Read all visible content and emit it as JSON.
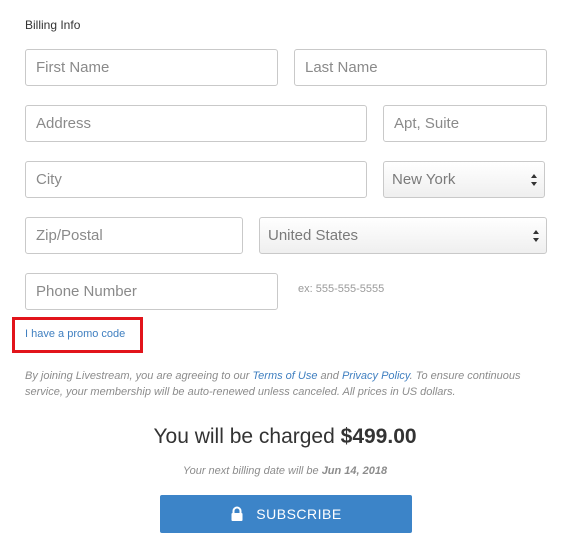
{
  "form": {
    "section_title": "Billing Info",
    "first_name": {
      "placeholder": "First Name",
      "value": ""
    },
    "last_name": {
      "placeholder": "Last Name",
      "value": ""
    },
    "address": {
      "placeholder": "Address",
      "value": ""
    },
    "apt_suite": {
      "placeholder": "Apt, Suite",
      "value": ""
    },
    "city": {
      "placeholder": "City",
      "value": ""
    },
    "state_select": {
      "selected": "New York"
    },
    "zip": {
      "placeholder": "Zip/Postal",
      "value": ""
    },
    "country_select": {
      "selected": "United States"
    },
    "phone": {
      "placeholder": "Phone Number",
      "value": ""
    },
    "phone_hint": "ex: 555-555-5555"
  },
  "promo": {
    "link_label": "I have a promo code"
  },
  "legal": {
    "prefix": "By joining Livestream, you are agreeing to our",
    "terms_link": "Terms of Use",
    "and": "and",
    "privacy_link": "Privacy Policy",
    "suffix": ". To ensure continuous service, your membership will be auto-renewed unless canceled. All prices in US dollars."
  },
  "charge": {
    "prefix": "You will be charged",
    "amount": "$499.00"
  },
  "next_billing": {
    "prefix": "Your next billing date will be",
    "date": "Jun 14, 2018"
  },
  "subscribe_button": {
    "label": "SUBSCRIBE",
    "icon": "lock-icon"
  },
  "colors": {
    "accent": "#3c84c8",
    "link": "#3f7fc0",
    "highlight": "#e2141b"
  }
}
